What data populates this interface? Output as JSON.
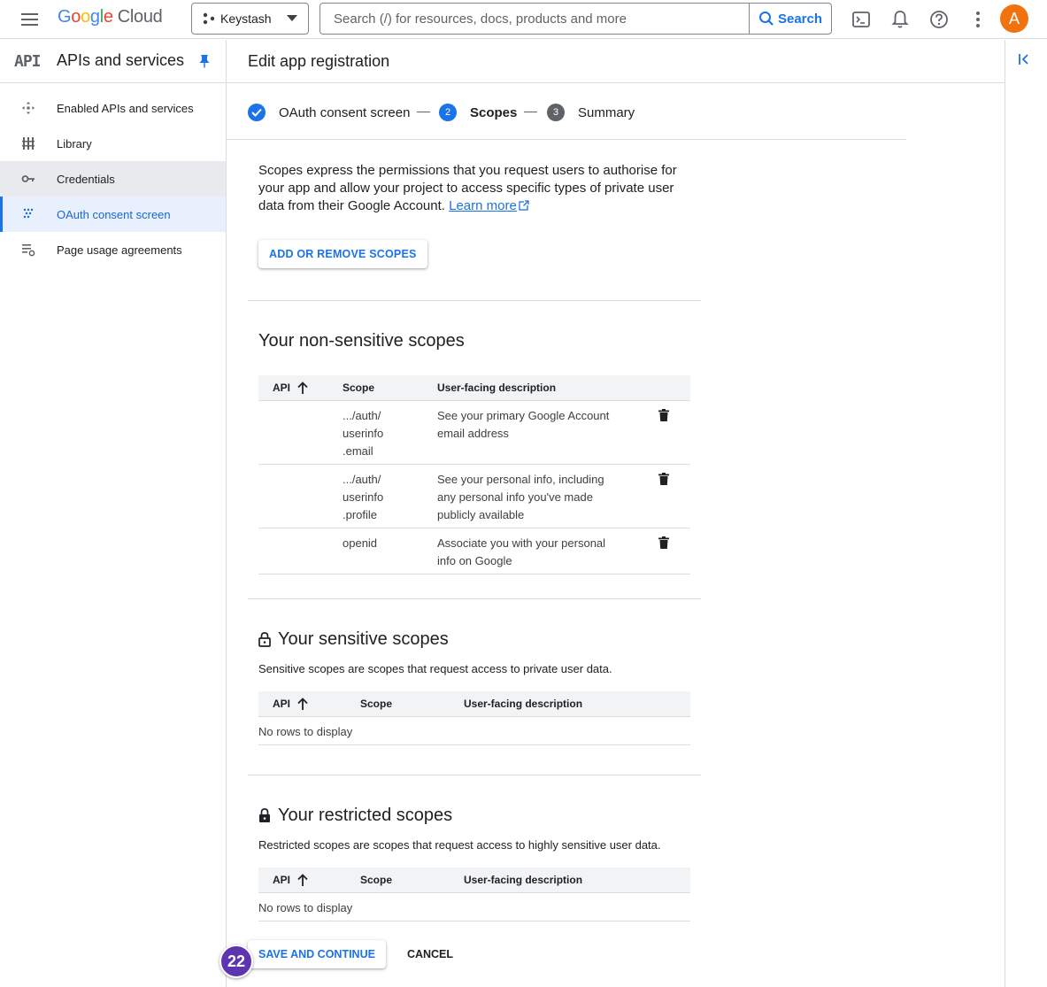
{
  "topbar": {
    "logo_google": "Google",
    "logo_cloud": "Cloud",
    "project": "Keystash",
    "search_placeholder": "Search (/) for resources, docs, products and more",
    "search_button": "Search",
    "avatar_letter": "A"
  },
  "sidebar": {
    "api_logo": "API",
    "title": "APIs and services",
    "items": [
      {
        "label": "Enabled APIs and services",
        "icon": "enabled-apis-icon"
      },
      {
        "label": "Library",
        "icon": "library-icon"
      },
      {
        "label": "Credentials",
        "icon": "key-icon"
      },
      {
        "label": "OAuth consent screen",
        "icon": "oauth-icon"
      },
      {
        "label": "Page usage agreements",
        "icon": "agreements-icon"
      }
    ]
  },
  "main": {
    "title": "Edit app registration",
    "steps": [
      {
        "label": "OAuth consent screen",
        "state": "done"
      },
      {
        "number": "2",
        "label": "Scopes",
        "state": "current"
      },
      {
        "number": "3",
        "label": "Summary",
        "state": "pending"
      }
    ],
    "intro": "Scopes express the permissions that you request users to authorise for your app and allow your project to access specific types of private user data from their Google Account.",
    "learn_more": "Learn more",
    "add_remove_button": "ADD OR REMOVE SCOPES",
    "non_sensitive": {
      "title": "Your non-sensitive scopes",
      "columns": [
        "API",
        "Scope",
        "User-facing description"
      ],
      "rows": [
        {
          "scope_1": ".../auth/",
          "scope_2": "userinfo",
          "scope_3": ".email",
          "description": "See your primary Google Account email address"
        },
        {
          "scope_1": ".../auth/",
          "scope_2": "userinfo",
          "scope_3": ".profile",
          "description": "See your personal info, including any personal info you've made publicly available"
        },
        {
          "scope_1": "openid",
          "description": "Associate you with your personal info on Google"
        }
      ]
    },
    "sensitive": {
      "title": "Your sensitive scopes",
      "description": "Sensitive scopes are scopes that request access to private user data.",
      "columns": [
        "API",
        "Scope",
        "User-facing description"
      ],
      "empty": "No rows to display"
    },
    "restricted": {
      "title": "Your restricted scopes",
      "description": "Restricted scopes are scopes that request access to highly sensitive user data.",
      "columns": [
        "API",
        "Scope",
        "User-facing description"
      ],
      "empty": "No rows to display"
    },
    "save_button": "SAVE AND CONTINUE",
    "cancel_button": "CANCEL"
  },
  "badge": "22",
  "colors": {
    "accent": "#1a73e8",
    "avatar": "#f1730f",
    "badge": "#5e35b1"
  }
}
